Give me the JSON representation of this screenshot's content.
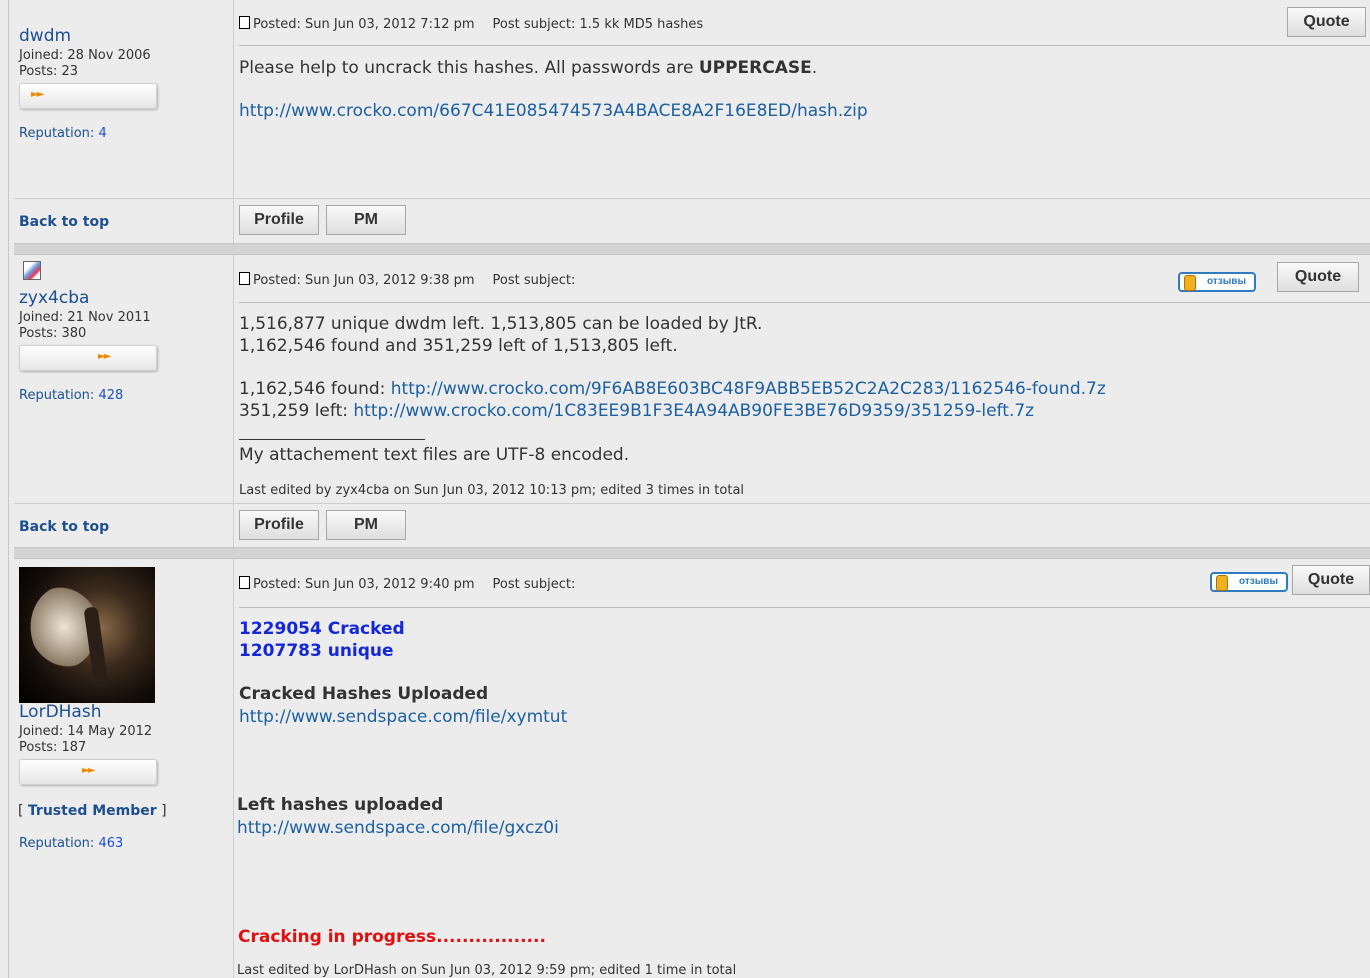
{
  "buttons": {
    "quote": "Quote",
    "profile": "Profile",
    "pm": "PM",
    "back_to_top": "Back to top",
    "reviews_badge": "отзывы"
  },
  "labels": {
    "posted": "Posted:",
    "post_subject": "Post subject:",
    "joined": "Joined:",
    "posts": "Posts:",
    "reputation": "Reputation:"
  },
  "posts": [
    {
      "author": "dwdm",
      "joined": "Joined: 28 Nov 2006",
      "posts": "Posts: 23",
      "reputation_value": "4",
      "posted": "Posted: Sun Jun 03, 2012 7:12 pm",
      "subject": "Post subject: 1.5 kk MD5 hashes",
      "body_line1_pre": "Please help to uncrack this hashes. All passwords are ",
      "body_line1_bold": "UPPERCASE",
      "body_line1_post": ".",
      "link": "http://www.crocko.com/667C41E085474573A4BACE8A2F16E8ED/hash.zip"
    },
    {
      "author": "zyx4cba",
      "joined": "Joined: 21 Nov 2011",
      "posts": "Posts: 380",
      "reputation_value": "428",
      "posted": "Posted: Sun Jun 03, 2012 9:38 pm",
      "subject": "Post subject:",
      "line1": "1,516,877 unique dwdm left. 1,513,805 can be loaded by JtR.",
      "line2": "1,162,546 found and 351,259 left of 1,513,805 left.",
      "found_label": "1,162,546 found: ",
      "found_link": "http://www.crocko.com/9F6AB8E603BC48F9ABB5EB52C2A2C283/1162546-found.7z",
      "left_label": "351,259 left: ",
      "left_link": "http://www.crocko.com/1C83EE9B1F3E4A94AB90FE3BE76D9359/351259-left.7z",
      "signature": "My attachement text files are UTF-8 encoded.",
      "edited": "Last edited by zyx4cba on Sun Jun 03, 2012 10:13 pm; edited 3 times in total"
    },
    {
      "author": "LorDHash",
      "joined": "Joined: 14 May 2012",
      "posts": "Posts: 187",
      "rank": "Trusted Member",
      "reputation_value": "463",
      "posted": "Posted: Sun Jun 03, 2012 9:40 pm",
      "subject": "Post subject:",
      "cracked": "1229054 Cracked",
      "unique": "1207783 unique",
      "cracked_heading": "Cracked Hashes Uploaded",
      "cracked_link": "http://www.sendspace.com/file/xymtut",
      "left_heading": "Left hashes uploaded",
      "left_link": "http://www.sendspace.com/file/gxcz0i",
      "progress": "Cracking in progress.................",
      "edited": "Last edited by LorDHash on Sun Jun 03, 2012 9:59 pm; edited 1 time in total"
    }
  ],
  "colors": {
    "link": "#1d5fa0",
    "username": "#1d4f91",
    "highlight_blue": "#1427d8",
    "alert_red": "#e01010",
    "rank_arrow": "#f08a00"
  }
}
